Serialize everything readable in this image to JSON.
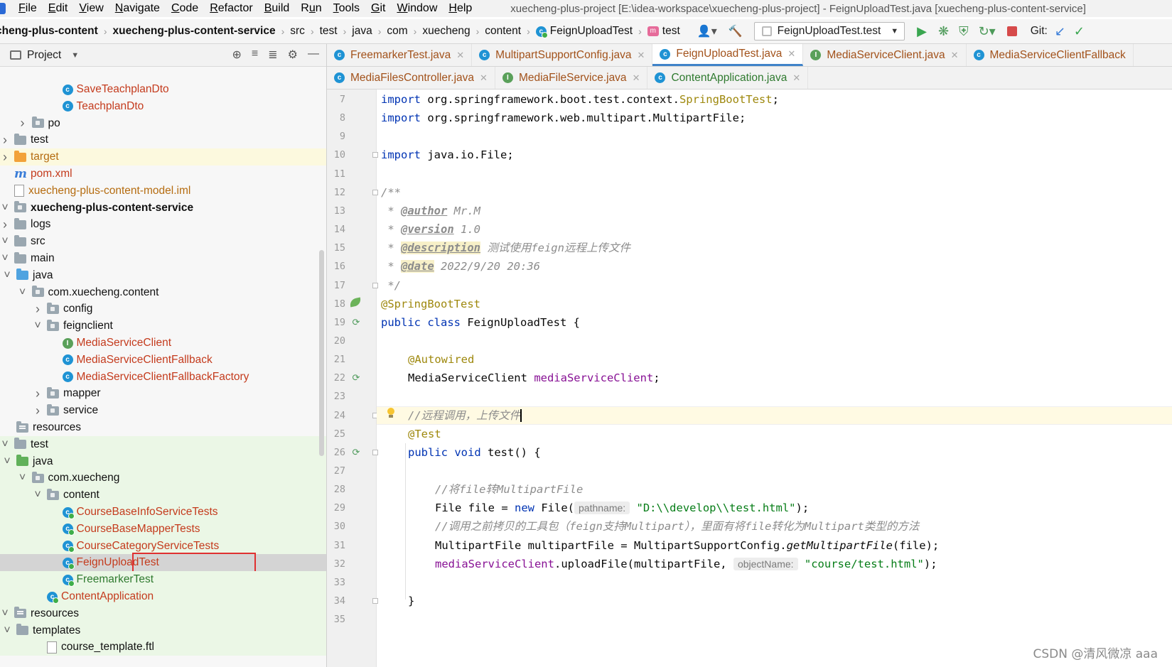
{
  "menu": {
    "items": [
      {
        "label": "File",
        "mnemonic": "F"
      },
      {
        "label": "Edit",
        "mnemonic": "E"
      },
      {
        "label": "View",
        "mnemonic": "V"
      },
      {
        "label": "Navigate",
        "mnemonic": "N"
      },
      {
        "label": "Code",
        "mnemonic": "C"
      },
      {
        "label": "Refactor",
        "mnemonic": "R"
      },
      {
        "label": "Build",
        "mnemonic": "B"
      },
      {
        "label": "Run",
        "mnemonic": "u"
      },
      {
        "label": "Tools",
        "mnemonic": "T"
      },
      {
        "label": "Git",
        "mnemonic": "G"
      },
      {
        "label": "Window",
        "mnemonic": "W"
      },
      {
        "label": "Help",
        "mnemonic": "H"
      }
    ],
    "window_title": "xuecheng-plus-project [E:\\idea-workspace\\xuecheng-plus-project] - FeignUploadTest.java [xuecheng-plus-content-service]"
  },
  "breadcrumbs": [
    "cheng-plus-content",
    "xuecheng-plus-content-service",
    "src",
    "test",
    "java",
    "com",
    "xuecheng",
    "content",
    "FeignUploadTest",
    "test"
  ],
  "toolbar": {
    "run_config": "FeignUploadTest.test",
    "git_label": "Git:"
  },
  "project_panel": {
    "title": "Project",
    "tree": [
      {
        "label": "SaveTeachplanDto",
        "depth": 9,
        "kind": "class",
        "color": "red"
      },
      {
        "label": "TeachplanDto",
        "depth": 9,
        "kind": "class",
        "color": "red"
      },
      {
        "label": "po",
        "depth": 7,
        "kind": "package",
        "arrow": "right"
      },
      {
        "label": "test",
        "depth": 5,
        "kind": "folder",
        "arrow": "right"
      },
      {
        "label": "target",
        "depth": 4,
        "kind": "folder-orange",
        "arrow": "right",
        "color": "orange",
        "highlight": "target"
      },
      {
        "label": "pom.xml",
        "depth": 4,
        "kind": "maven",
        "color": "red"
      },
      {
        "label": "xuecheng-plus-content-model.iml",
        "depth": 4,
        "kind": "file",
        "color": "orange"
      },
      {
        "label": "xuecheng-plus-content-service",
        "depth": 2,
        "kind": "module",
        "arrow": "down",
        "bold": true
      },
      {
        "label": "logs",
        "depth": 4,
        "kind": "folder",
        "arrow": "right"
      },
      {
        "label": "src",
        "depth": 4,
        "kind": "folder",
        "arrow": "down"
      },
      {
        "label": "main",
        "depth": 5,
        "kind": "folder",
        "arrow": "down"
      },
      {
        "label": "java",
        "depth": 6,
        "kind": "folder-blue",
        "arrow": "down"
      },
      {
        "label": "com.xuecheng.content",
        "depth": 7,
        "kind": "package",
        "arrow": "down"
      },
      {
        "label": "config",
        "depth": 8,
        "kind": "package",
        "arrow": "right"
      },
      {
        "label": "feignclient",
        "depth": 8,
        "kind": "package",
        "arrow": "down"
      },
      {
        "label": "MediaServiceClient",
        "depth": 9,
        "kind": "interface",
        "color": "red"
      },
      {
        "label": "MediaServiceClientFallback",
        "depth": 9,
        "kind": "class",
        "color": "red"
      },
      {
        "label": "MediaServiceClientFallbackFactory",
        "depth": 9,
        "kind": "class",
        "color": "red"
      },
      {
        "label": "mapper",
        "depth": 8,
        "kind": "package",
        "arrow": "right"
      },
      {
        "label": "service",
        "depth": 8,
        "kind": "package",
        "arrow": "right"
      },
      {
        "label": "resources",
        "depth": 6,
        "kind": "resources"
      },
      {
        "label": "test",
        "depth": 5,
        "kind": "folder",
        "arrow": "down",
        "highlight": "test"
      },
      {
        "label": "java",
        "depth": 6,
        "kind": "folder-green",
        "arrow": "down",
        "highlight": "test"
      },
      {
        "label": "com.xuecheng",
        "depth": 7,
        "kind": "package",
        "arrow": "down",
        "highlight": "test"
      },
      {
        "label": "content",
        "depth": 8,
        "kind": "package",
        "arrow": "down",
        "highlight": "test"
      },
      {
        "label": "CourseBaseInfoServiceTests",
        "depth": 9,
        "kind": "testclass",
        "color": "red",
        "highlight": "test"
      },
      {
        "label": "CourseBaseMapperTests",
        "depth": 9,
        "kind": "testclass",
        "color": "red",
        "highlight": "test"
      },
      {
        "label": "CourseCategoryServiceTests",
        "depth": 9,
        "kind": "testclass",
        "color": "red",
        "highlight": "test"
      },
      {
        "label": "FeignUploadTest",
        "depth": 9,
        "kind": "testclass",
        "color": "red",
        "highlight": "selected",
        "boxed": true
      },
      {
        "label": "FreemarkerTest",
        "depth": 9,
        "kind": "testclass",
        "color": "green",
        "highlight": "test"
      },
      {
        "label": "ContentApplication",
        "depth": 8,
        "kind": "testclass",
        "color": "red",
        "highlight": "test"
      },
      {
        "label": "resources",
        "depth": 5,
        "kind": "resources",
        "arrow": "down",
        "highlight": "test"
      },
      {
        "label": "templates",
        "depth": 6,
        "kind": "folder",
        "arrow": "down",
        "highlight": "test"
      },
      {
        "label": "course_template.ftl",
        "depth": 8,
        "kind": "file",
        "highlight": "test"
      }
    ]
  },
  "tabs": {
    "row1": [
      {
        "label": "FreemarkerTest.java",
        "icon": "c",
        "active": false
      },
      {
        "label": "MultipartSupportConfig.java",
        "icon": "c",
        "active": false
      },
      {
        "label": "FeignUploadTest.java",
        "icon": "c",
        "active": true
      },
      {
        "label": "MediaServiceClient.java",
        "icon": "i",
        "active": false
      },
      {
        "label": "MediaServiceClientFallback",
        "icon": "c",
        "active": false
      }
    ],
    "row2": [
      {
        "label": "MediaFilesController.java",
        "icon": "c",
        "active": false
      },
      {
        "label": "MediaFileService.java",
        "icon": "i",
        "active": false
      },
      {
        "label": "ContentApplication.java",
        "icon": "c",
        "active": false,
        "green": true
      }
    ]
  },
  "editor": {
    "line_numbers": [
      "7",
      "8",
      "9",
      "10",
      "11",
      "12",
      "13",
      "14",
      "15",
      "16",
      "17",
      "18",
      "19",
      "20",
      "21",
      "22",
      "23",
      "24",
      "25",
      "26",
      "27",
      "28",
      "29",
      "30",
      "31",
      "32",
      "33",
      "34",
      "35"
    ],
    "lines": [
      {
        "n": "7",
        "indent": 0,
        "tokens": [
          [
            "kw",
            "import"
          ],
          [
            "",
            "org.springframework.boot.test.context."
          ],
          [
            "ann",
            "SpringBootTest"
          ],
          [
            "",
            ";"
          ]
        ]
      },
      {
        "n": "8",
        "indent": 0,
        "tokens": [
          [
            "kw",
            "import"
          ],
          [
            "",
            "org.springframework.web.multipart.MultipartFile;"
          ]
        ]
      },
      {
        "n": "9",
        "indent": 0,
        "tokens": []
      },
      {
        "n": "10",
        "indent": 0,
        "tokens": [
          [
            "kw",
            "import"
          ],
          [
            "",
            "java.io.File;"
          ]
        ]
      },
      {
        "n": "11",
        "indent": 0,
        "tokens": []
      },
      {
        "n": "12",
        "indent": 0,
        "tokens": [
          [
            "cmt",
            "/**"
          ]
        ]
      },
      {
        "n": "13",
        "indent": 0,
        "tokens": [
          [
            "cmt",
            " * "
          ],
          [
            "doc-tag",
            "@author"
          ],
          [
            "cmt",
            " Mr.M"
          ]
        ]
      },
      {
        "n": "14",
        "indent": 0,
        "tokens": [
          [
            "cmt",
            " * "
          ],
          [
            "doc-tag",
            "@version"
          ],
          [
            "cmt",
            " 1.0"
          ]
        ]
      },
      {
        "n": "15",
        "indent": 0,
        "tokens": [
          [
            "cmt",
            " * "
          ],
          [
            "doc-tag hl",
            "@description"
          ],
          [
            "cmt",
            " 测试使用feign远程上传文件"
          ]
        ]
      },
      {
        "n": "16",
        "indent": 0,
        "tokens": [
          [
            "cmt",
            " * "
          ],
          [
            "doc-tag hl",
            "@date"
          ],
          [
            "cmt",
            " 2022/9/20 20:36"
          ]
        ]
      },
      {
        "n": "17",
        "indent": 0,
        "tokens": [
          [
            "cmt",
            " */"
          ]
        ]
      },
      {
        "n": "18",
        "indent": 0,
        "tokens": [
          [
            "ann",
            "@SpringBootTest"
          ]
        ]
      },
      {
        "n": "19",
        "indent": 0,
        "tokens": [
          [
            "kw",
            "public class"
          ],
          [
            "",
            "FeignUploadTest {"
          ]
        ]
      },
      {
        "n": "20",
        "indent": 0,
        "tokens": []
      },
      {
        "n": "21",
        "indent": 1,
        "tokens": [
          [
            "ann",
            "@Autowired"
          ]
        ]
      },
      {
        "n": "22",
        "indent": 1,
        "tokens": [
          [
            "",
            "MediaServiceClient "
          ],
          [
            "field",
            "mediaServiceClient"
          ],
          [
            "",
            ";"
          ]
        ]
      },
      {
        "n": "23",
        "indent": 0,
        "tokens": []
      },
      {
        "n": "24",
        "indent": 1,
        "tokens": [
          [
            "cmt",
            "//远程调用，上传文件"
          ]
        ]
      },
      {
        "n": "25",
        "indent": 1,
        "tokens": [
          [
            "ann",
            "@Test"
          ]
        ]
      },
      {
        "n": "26",
        "indent": 1,
        "tokens": [
          [
            "kw",
            "public void"
          ],
          [
            "",
            "test() {"
          ]
        ]
      },
      {
        "n": "27",
        "indent": 0,
        "tokens": []
      },
      {
        "n": "28",
        "indent": 2,
        "tokens": [
          [
            "cmt",
            "//将file转MultipartFile"
          ]
        ]
      },
      {
        "n": "29",
        "indent": 2,
        "tokens": [
          [
            "",
            "File file = "
          ],
          [
            "kw",
            "new"
          ],
          [
            "",
            "File("
          ],
          [
            "hint",
            "pathname:"
          ],
          [
            "str",
            "\"D:\\\\develop\\\\test.html\""
          ],
          [
            "",
            ");"
          ]
        ]
      },
      {
        "n": "30",
        "indent": 2,
        "tokens": [
          [
            "cmt",
            "//调用之前拷贝的工具包（feign支持Multipart），里面有将file转化为Multipart类型的方法"
          ]
        ]
      },
      {
        "n": "31",
        "indent": 2,
        "tokens": [
          [
            "",
            "MultipartFile multipartFile = MultipartSupportConfig."
          ],
          [
            "method-it",
            "getMultipartFile"
          ],
          [
            "",
            "(file);"
          ]
        ]
      },
      {
        "n": "32",
        "indent": 2,
        "tokens": [
          [
            "field",
            "mediaServiceClient"
          ],
          [
            "",
            ".uploadFile(multipartFile, "
          ],
          [
            "hint",
            "objectName:"
          ],
          [
            "str",
            "\"course/test.html\""
          ],
          [
            "",
            ");"
          ]
        ]
      },
      {
        "n": "33",
        "indent": 0,
        "tokens": []
      },
      {
        "n": "34",
        "indent": 1,
        "tokens": [
          [
            "",
            "}"
          ]
        ]
      },
      {
        "n": "35",
        "indent": 0,
        "tokens": []
      }
    ]
  },
  "watermark": "CSDN @清风微凉 aaa"
}
